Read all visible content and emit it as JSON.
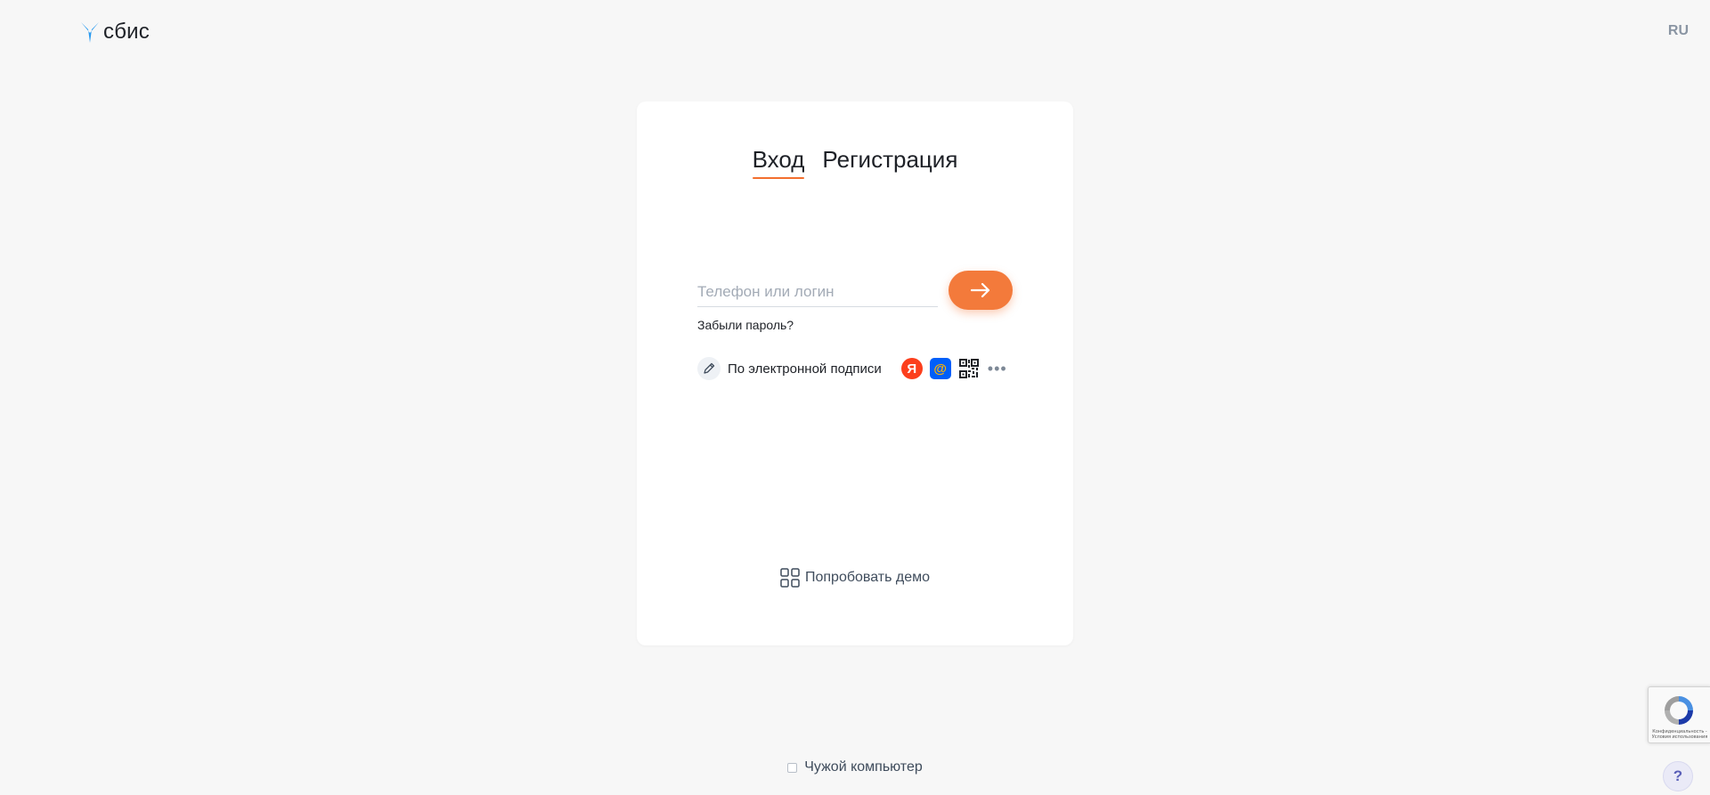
{
  "header": {
    "logo_text": "сбис",
    "lang": "RU"
  },
  "login": {
    "tabs": [
      {
        "label": "Вход",
        "active": true
      },
      {
        "label": "Регистрация",
        "active": false
      }
    ],
    "input_placeholder": "Телефон или логин",
    "input_value": "",
    "forgot_label": "Забыли пароль?",
    "signature_label": "По электронной подписи",
    "social": [
      {
        "name": "yandex",
        "glyph": "Я",
        "color": "#fc3f1d"
      },
      {
        "name": "mailru",
        "glyph": "@",
        "color": "#005ff9"
      },
      {
        "name": "qr-code",
        "glyph": ""
      },
      {
        "name": "more",
        "glyph": "•••"
      }
    ],
    "demo_label": "Попробовать демо"
  },
  "footer": {
    "foreign_computer_label": "Чужой компьютер",
    "foreign_computer_checked": false,
    "recaptcha_text": "Конфиденциальность - Условия использования",
    "help_label": "?"
  },
  "colors": {
    "accent": "#f37a3b",
    "background": "#f7f7f7",
    "card": "#ffffff",
    "logo_blue": "#2b9bf0"
  }
}
